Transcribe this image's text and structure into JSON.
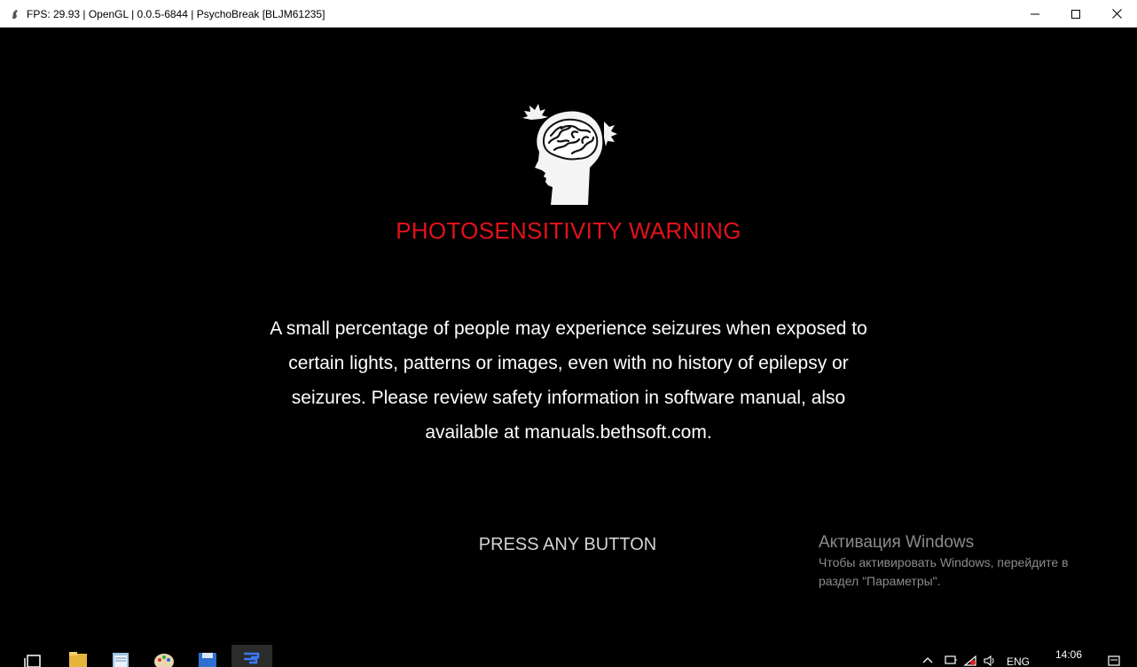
{
  "window": {
    "title": "FPS: 29.93 | OpenGL | 0.0.5-6844 | PsychoBreak [BLJM61235]",
    "icon": "rpcs3-app-icon",
    "controls": {
      "minimize": "minimize-icon",
      "maximize": "maximize-icon",
      "close": "close-icon"
    }
  },
  "screen": {
    "icon": "brain-head-icon",
    "warning_title": "PHOTOSENSITIVITY WARNING",
    "warning_lines": [
      "A small percentage of people may experience seizures when exposed to",
      "certain lights, patterns or images, even with no history of epilepsy or",
      "seizures. Please review safety information in software manual, also",
      "available at manuals.bethsoft.com."
    ],
    "prompt": "PRESS ANY BUTTON"
  },
  "activation": {
    "title": "Активация Windows",
    "text": "Чтобы активировать Windows, перейдите в раздел \"Параметры\"."
  },
  "taskbar": {
    "apps": [
      {
        "name": "task-view-icon"
      },
      {
        "name": "file-explorer-icon"
      },
      {
        "name": "notepad-icon"
      },
      {
        "name": "paint-icon"
      },
      {
        "name": "save-disk-icon"
      },
      {
        "name": "rpcs3-icon",
        "active": true
      }
    ],
    "tray": {
      "language": "ENG",
      "time": "14:06"
    }
  },
  "colors": {
    "warning_red": "#e3121b",
    "background": "#000000",
    "titlebar": "#ffffff"
  }
}
